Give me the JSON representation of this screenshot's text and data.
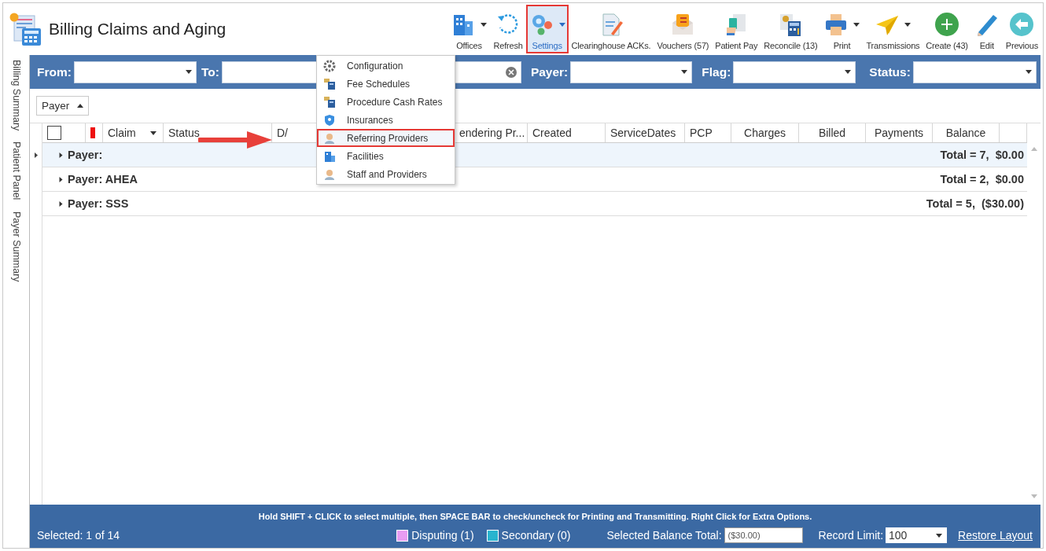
{
  "window": {
    "title": "Billing Claims and Aging"
  },
  "toolbar": [
    {
      "label": "Offices",
      "dropdown": true,
      "selected": false
    },
    {
      "label": "Refresh",
      "dropdown": false,
      "selected": false
    },
    {
      "label": "Settings",
      "dropdown": true,
      "selected": true
    },
    {
      "label": "Clearinghouse ACKs.",
      "dropdown": false,
      "selected": false
    },
    {
      "label": "Vouchers (57)",
      "dropdown": false,
      "selected": false
    },
    {
      "label": "Patient Pay",
      "dropdown": false,
      "selected": false
    },
    {
      "label": "Reconcile (13)",
      "dropdown": false,
      "selected": false
    },
    {
      "label": "Print",
      "dropdown": true,
      "selected": false
    },
    {
      "label": "Transmissions",
      "dropdown": true,
      "selected": false
    },
    {
      "label": "Create (43)",
      "dropdown": false,
      "selected": false
    },
    {
      "label": "Edit",
      "dropdown": false,
      "selected": false
    },
    {
      "label": "Previous",
      "dropdown": false,
      "selected": false
    }
  ],
  "settings_menu": {
    "items": [
      {
        "label": "Configuration",
        "selected": false
      },
      {
        "label": "Fee Schedules",
        "selected": false
      },
      {
        "label": "Procedure Cash Rates",
        "selected": false
      },
      {
        "label": "Insurances",
        "selected": false
      },
      {
        "label": "Referring Providers",
        "selected": true
      },
      {
        "label": "Facilities",
        "selected": false
      },
      {
        "label": "Staff and Providers",
        "selected": false
      }
    ]
  },
  "side_tabs": [
    {
      "label": "Billing Summary"
    },
    {
      "label": "Patient Panel"
    },
    {
      "label": "Payer Summary"
    }
  ],
  "filters": [
    {
      "label": "From:",
      "kind": "combo"
    },
    {
      "label": "To:",
      "kind": "clearable"
    },
    {
      "label": "Payer:",
      "kind": "combo"
    },
    {
      "label": "Flag:",
      "kind": "combo"
    },
    {
      "label": "Status:",
      "kind": "combo"
    }
  ],
  "group_by": {
    "label": "Payer"
  },
  "table": {
    "columns": [
      {
        "kind": "checkbox",
        "checked": false
      },
      {
        "kind": "flag"
      },
      {
        "kind": "text",
        "label": "Claim",
        "filter": true
      },
      {
        "kind": "text",
        "label": "Status",
        "filter": false
      },
      {
        "kind": "text",
        "label": "D/",
        "filter": false
      },
      {
        "kind": "text",
        "label": "endering Pr...",
        "filter": false
      },
      {
        "kind": "text",
        "label": "Created",
        "filter": false
      },
      {
        "kind": "text",
        "label": "ServiceDates",
        "filter": false
      },
      {
        "kind": "text",
        "label": "PCP",
        "filter": false
      },
      {
        "kind": "number",
        "label": "Charges",
        "filter": false
      },
      {
        "kind": "number",
        "label": "Billed",
        "filter": false
      },
      {
        "kind": "number",
        "label": "Payments",
        "filter": false
      },
      {
        "kind": "number",
        "label": "Balance",
        "filter": false
      },
      {
        "kind": "blank"
      }
    ],
    "groups": [
      {
        "label": "Payer:",
        "total": "Total = 7,  $0.00",
        "selected": true,
        "expanded": false
      },
      {
        "label": "Payer: AHEA",
        "total": "Total = 2,  $0.00",
        "selected": false,
        "expanded": false
      },
      {
        "label": "Payer: SSS",
        "total": "Total = 5,  ($30.00)",
        "selected": false,
        "expanded": false
      }
    ]
  },
  "footer": {
    "hint": "Hold SHIFT + CLICK to select multiple, then SPACE BAR to check/uncheck for Printing and Transmitting. Right Click for Extra Options.",
    "selected_count": "Selected: 1 of 14",
    "legend": [
      {
        "label": "Disputing (1)",
        "color": "#e79cf2"
      },
      {
        "label": "Secondary (0)",
        "color": "#28b4cf"
      }
    ],
    "balance_label": "Selected Balance Total:",
    "balance_value": "($30.00)",
    "record_limit_label": "Record Limit:",
    "record_limit": "100",
    "restore": "Restore Layout"
  }
}
